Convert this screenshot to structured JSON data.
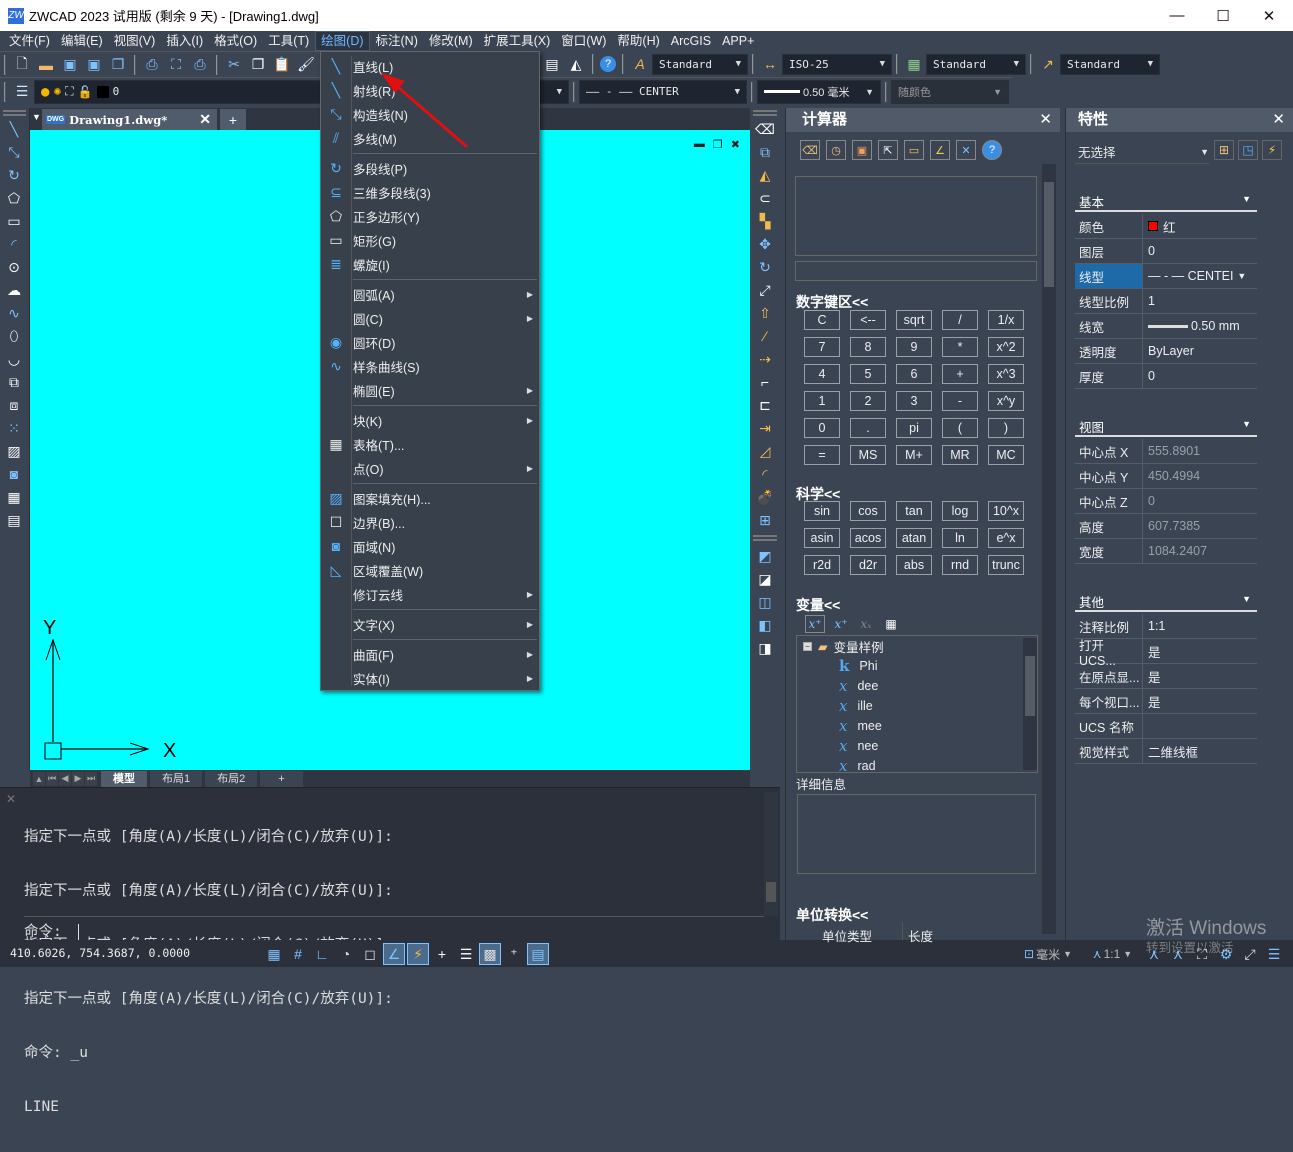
{
  "window": {
    "title": "ZWCAD 2023 试用版 (剩余 9 天) - [Drawing1.dwg]",
    "logo": "ZW",
    "minimize": "—",
    "maximize": "☐",
    "close": "✕"
  },
  "menubar": [
    "文件(F)",
    "编辑(E)",
    "视图(V)",
    "插入(I)",
    "格式(O)",
    "工具(T)",
    "绘图(D)",
    "标注(N)",
    "修改(M)",
    "扩展工具(X)",
    "窗口(W)",
    "帮助(H)",
    "ArcGIS",
    "APP+"
  ],
  "menubar_active": "绘图(D)",
  "toolbar": {
    "text_style": "Standard",
    "dim_style": "ISO-25",
    "table_style": "Standard",
    "mleader_style": "Standard",
    "layer_value": "0",
    "linetype": "—— - —— CENTER",
    "lineweight": "0.50 毫米",
    "plot_color": "随颜色"
  },
  "document_tab": {
    "name": "Drawing1.dwg*",
    "badge": "DWG"
  },
  "draw_menu": [
    {
      "label": "直线(L)",
      "icon": "line-icon"
    },
    {
      "label": "射线(R)",
      "icon": "ray-icon"
    },
    {
      "label": "构造线(N)",
      "icon": "xline-icon"
    },
    {
      "label": "多线(M)",
      "icon": "mline-icon"
    },
    {
      "sep": true
    },
    {
      "label": "多段线(P)",
      "icon": "polyline-icon"
    },
    {
      "label": "三维多段线(3)",
      "icon": "3dpolyline-icon"
    },
    {
      "label": "正多边形(Y)",
      "icon": "polygon-icon"
    },
    {
      "label": "矩形(G)",
      "icon": "rectangle-icon"
    },
    {
      "label": "螺旋(I)",
      "icon": "helix-icon"
    },
    {
      "sep": true
    },
    {
      "label": "圆弧(A)",
      "sub": true
    },
    {
      "label": "圆(C)",
      "sub": true
    },
    {
      "label": "圆环(D)",
      "icon": "donut-icon"
    },
    {
      "label": "样条曲线(S)",
      "icon": "spline-icon"
    },
    {
      "label": "椭圆(E)",
      "sub": true
    },
    {
      "sep": true
    },
    {
      "label": "块(K)",
      "sub": true
    },
    {
      "label": "表格(T)...",
      "icon": "table-icon"
    },
    {
      "label": "点(O)",
      "sub": true
    },
    {
      "sep": true
    },
    {
      "label": "图案填充(H)...",
      "icon": "hatch-icon"
    },
    {
      "label": "边界(B)...",
      "icon": "boundary-icon"
    },
    {
      "label": "面域(N)",
      "icon": "region-icon"
    },
    {
      "label": "区域覆盖(W)",
      "icon": "wipeout-icon"
    },
    {
      "label": "修订云线",
      "sub": true
    },
    {
      "sep": true
    },
    {
      "label": "文字(X)",
      "sub": true
    },
    {
      "sep": true
    },
    {
      "label": "曲面(F)",
      "sub": true
    },
    {
      "label": "实体(I)",
      "sub": true
    }
  ],
  "ucs": {
    "x": "X",
    "y": "Y"
  },
  "layout_tabs": [
    "模型",
    "布局1",
    "布局2",
    "+"
  ],
  "command": {
    "history": [
      "指定下一点或 [角度(A)/长度(L)/闭合(C)/放弃(U)]:",
      "指定下一点或 [角度(A)/长度(L)/闭合(C)/放弃(U)]:",
      "指定下一点或 [角度(A)/长度(L)/闭合(C)/放弃(U)]:",
      "指定下一点或 [角度(A)/长度(L)/闭合(C)/放弃(U)]:",
      "命令: _u",
      "LINE"
    ],
    "prompt": "命令:",
    "input_value": ""
  },
  "status": {
    "coords": "410.6026, 754.3687, 0.0000",
    "units": "毫米",
    "scale": "1:1"
  },
  "calculator": {
    "title": "计算器",
    "numpad_title": "数字键区<<",
    "numpad": [
      [
        "C",
        "<--",
        "sqrt",
        "/",
        "1/x"
      ],
      [
        "7",
        "8",
        "9",
        "*",
        "x^2"
      ],
      [
        "4",
        "5",
        "6",
        "+",
        "x^3"
      ],
      [
        "1",
        "2",
        "3",
        "-",
        "x^y"
      ],
      [
        "0",
        ".",
        "pi",
        "(",
        ")"
      ],
      [
        "=",
        "MS",
        "M+",
        "MR",
        "MC"
      ]
    ],
    "sci_title": "科学<<",
    "sci": [
      [
        "sin",
        "cos",
        "tan",
        "log",
        "10^x"
      ],
      [
        "asin",
        "acos",
        "atan",
        "ln",
        "e^x"
      ],
      [
        "r2d",
        "d2r",
        "abs",
        "rnd",
        "trunc"
      ]
    ],
    "vars_title": "变量<<",
    "vars_root": "变量样例",
    "vars": [
      {
        "type": "k",
        "name": "Phi"
      },
      {
        "type": "x",
        "name": "dee"
      },
      {
        "type": "x",
        "name": "ille"
      },
      {
        "type": "x",
        "name": "mee"
      },
      {
        "type": "x",
        "name": "nee"
      },
      {
        "type": "x",
        "name": "rad"
      }
    ],
    "details_title": "详细信息",
    "unit_title": "单位转换<<",
    "unit_type_label": "单位类型",
    "unit_type_value": "长度"
  },
  "properties": {
    "title": "特性",
    "selection": "无选择",
    "basic_title": "基本",
    "basic": [
      {
        "k": "颜色",
        "v": "红",
        "swatch": "#ff0000"
      },
      {
        "k": "图层",
        "v": "0"
      },
      {
        "k": "线型",
        "v": "— - — CENTEI",
        "selected": true
      },
      {
        "k": "线型比例",
        "v": "1"
      },
      {
        "k": "线宽",
        "v": "0.50 mm"
      },
      {
        "k": "透明度",
        "v": "ByLayer"
      },
      {
        "k": "厚度",
        "v": "0"
      }
    ],
    "view_title": "视图",
    "view": [
      {
        "k": "中心点 X",
        "v": "555.8901"
      },
      {
        "k": "中心点 Y",
        "v": "450.4994"
      },
      {
        "k": "中心点 Z",
        "v": "0"
      },
      {
        "k": "高度",
        "v": "607.7385"
      },
      {
        "k": "宽度",
        "v": "1084.2407"
      }
    ],
    "other_title": "其他",
    "other": [
      {
        "k": "注释比例",
        "v": "1:1"
      },
      {
        "k": "打开 UCS...",
        "v": "是"
      },
      {
        "k": "在原点显...",
        "v": "是"
      },
      {
        "k": "每个视口...",
        "v": "是"
      },
      {
        "k": "UCS 名称",
        "v": ""
      },
      {
        "k": "视觉样式",
        "v": "二维线框"
      }
    ]
  },
  "watermark": {
    "line1": "激活 Windows",
    "line2": "转到设置以激活"
  },
  "colors": {
    "canvas": "#00ffff",
    "panel": "#3b4453",
    "accent": "#55b2ff",
    "selected_row": "#1e6aa8",
    "annotation_arrow": "#e01010"
  }
}
